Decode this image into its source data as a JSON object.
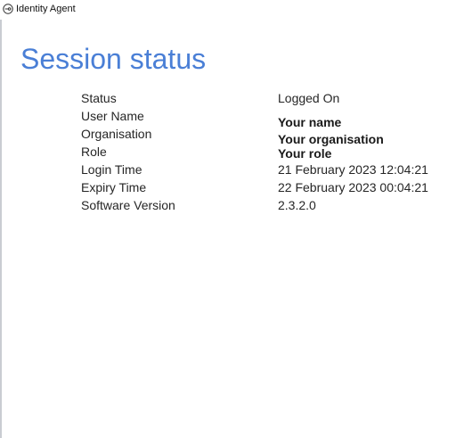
{
  "window": {
    "title": "Identity Agent",
    "icon": "key-icon"
  },
  "page": {
    "title": "Session status"
  },
  "session": {
    "rows": [
      {
        "label": "Status",
        "value": "Logged On",
        "emphasis": false
      },
      {
        "label": "User Name",
        "value": "Your name",
        "emphasis": true
      },
      {
        "label": "Organisation",
        "value": "Your organisation",
        "emphasis": true
      },
      {
        "label": "Role",
        "value": "Your role",
        "emphasis": true
      },
      {
        "label": "Login Time",
        "value": "21 February 2023 12:04:21",
        "emphasis": false
      },
      {
        "label": "Expiry Time",
        "value": "22 February 2023 00:04:21",
        "emphasis": false
      },
      {
        "label": "Software Version",
        "value": "2.3.2.0",
        "emphasis": false
      }
    ]
  },
  "colors": {
    "title_accent": "#4a7fd6",
    "text": "#262626",
    "border": "#c9ccd2"
  }
}
